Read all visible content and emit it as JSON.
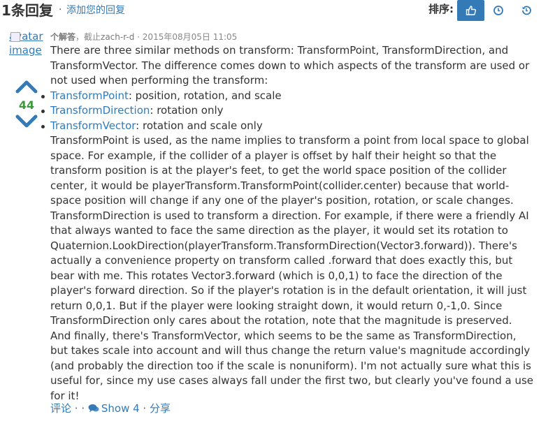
{
  "header": {
    "title": "1条回复",
    "separator": "·",
    "add_reply": "添加您的回复",
    "sort_label": "排序:",
    "sort_options": [
      {
        "icon": "thumbs-up-icon",
        "active": true
      },
      {
        "icon": "clock-icon",
        "active": false
      },
      {
        "icon": "history-icon",
        "active": false
      }
    ]
  },
  "answer": {
    "avatar_alt": "avatar image",
    "avatar_alt_line1": "avatar",
    "avatar_alt_line2": "image",
    "votes": "44",
    "meta": {
      "label": "个解答",
      "sep1": "，截止",
      "user": "zach-r-d",
      "sep2": " · ",
      "date": "2015年08月05日 11:05"
    },
    "intro": "There are three similar methods on transform: TransformPoint, TransformDirection, and TransformVector. The difference comes down to which aspects of the transform are used or not used when performing the transform:",
    "list": [
      {
        "link": "TransformPoint",
        "rest": ": position, rotation, and scale"
      },
      {
        "link": "TransformDirection",
        "rest": ": rotation only"
      },
      {
        "link": "TransformVector",
        "rest": ": rotation and scale only"
      }
    ],
    "body": "TransformPoint is used, as the name implies to transform a point from local space to global space. For example, if the collider of a player is offset by half their height so that the transform position is at the player's feet, to get the world space position of the collider center, it would be playerTransform.TransformPoint(collider.center) because that world-space position will change if any one of the player's position, rotation, or scale changes. TransformDirection is used to transform a direction. For example, if there were a friendly AI that always wanted to face the same direction as the player, it would set its rotation to Quaternion.LookDirection(playerTransform.TransformDirection(Vector3.forward)). There's actually a convenience property on transform called .forward that does exactly this, but bear with me. This rotates Vector3.forward (which is 0,0,1) to face the direction of the player's forward direction. So if the player's rotation is in the default orientation, it will just return 0,0,1. But if the player were looking straight down, it would return 0,-1,0. Since TransformDirection only cares about the rotation, note that the magnitude is preserved. And finally, there's TransformVector, which seems to be the same as TransformDirection, but takes scale into account and will thus change the return value's magnitude accordingly (and probably the direction too if the scale is nonuniform). I'm not actually sure what this is useful for, since my use cases always fall under the first two, but clearly you've found a use for it!",
    "footer": {
      "comment": "评论",
      "sep1": " · · ",
      "show": "Show 4",
      "sep2": " · ",
      "share": "分享"
    }
  },
  "colors": {
    "link": "#337ab7",
    "vote_count": "#3a9a3a",
    "active_sort_bg": "#337ab7"
  }
}
